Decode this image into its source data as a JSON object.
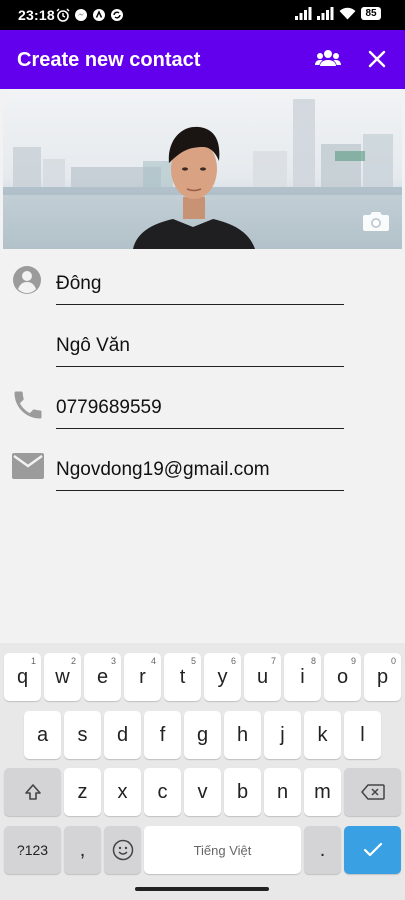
{
  "status_bar": {
    "time": "23:18",
    "battery": "85"
  },
  "app_bar": {
    "title": "Create new contact"
  },
  "form": {
    "first_name": "Đông",
    "last_name": "Ngô Văn",
    "phone": "0779689559",
    "email": "Ngovdong19@gmail.com"
  },
  "keyboard": {
    "row1": [
      {
        "letter": "q",
        "hint": "1"
      },
      {
        "letter": "w",
        "hint": "2"
      },
      {
        "letter": "e",
        "hint": "3"
      },
      {
        "letter": "r",
        "hint": "4"
      },
      {
        "letter": "t",
        "hint": "5"
      },
      {
        "letter": "y",
        "hint": "6"
      },
      {
        "letter": "u",
        "hint": "7"
      },
      {
        "letter": "i",
        "hint": "8"
      },
      {
        "letter": "o",
        "hint": "9"
      },
      {
        "letter": "p",
        "hint": "0"
      }
    ],
    "row2": [
      "a",
      "s",
      "d",
      "f",
      "g",
      "h",
      "j",
      "k",
      "l"
    ],
    "row3": [
      "z",
      "x",
      "c",
      "v",
      "b",
      "n",
      "m"
    ],
    "symbols_label": "?123",
    "comma": ",",
    "period": ".",
    "space_label": "Tiếng Việt"
  },
  "colors": {
    "app_bar": "#6200ee",
    "enter_key": "#3aa0e4"
  }
}
